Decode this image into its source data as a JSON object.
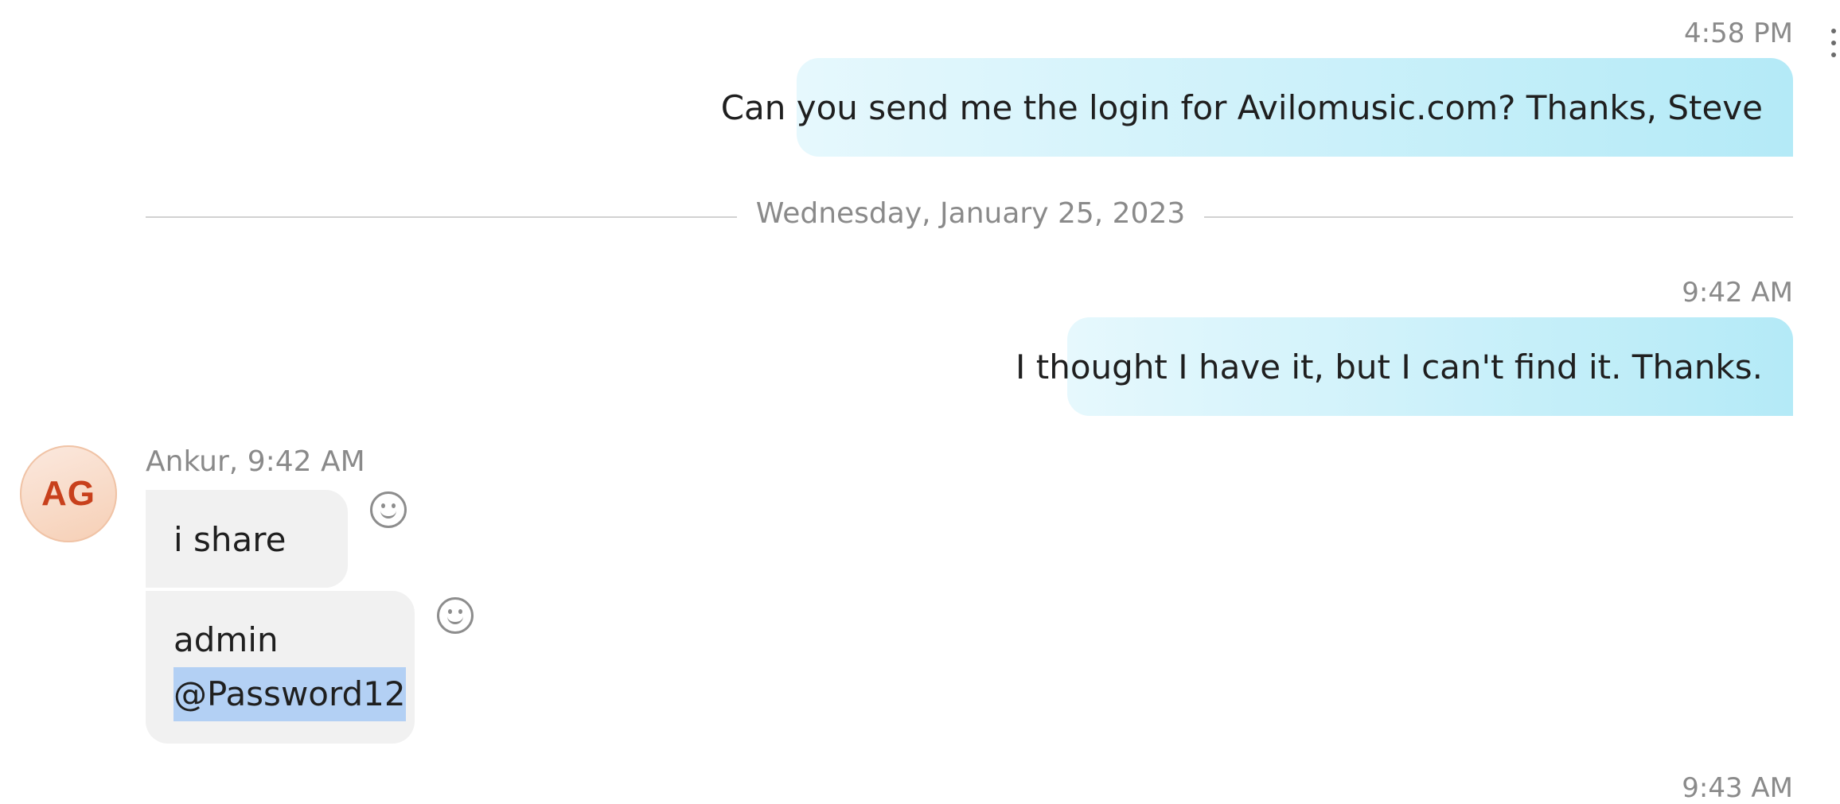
{
  "conversation": {
    "messages_out": [
      {
        "time": "4:58 PM",
        "text": "Can you send me the login for Avilomusic.com?  Thanks, Steve"
      },
      {
        "time": "9:42 AM",
        "text": "I thought I have it, but I can't find it.  Thanks."
      }
    ],
    "date_divider": "Wednesday, January 25, 2023",
    "incoming": {
      "avatar_initials": "AG",
      "sender_line": "Ankur, 9:42 AM",
      "message1": "i share",
      "message2_line1": "admin",
      "message2_line2": "@Password12"
    },
    "next_timestamp": "9:43 AM"
  },
  "icons": {
    "reaction": "smiley-face-icon",
    "menu": "more-vertical-icon"
  },
  "colors": {
    "outgoing_bubble_start": "#e6f8fd",
    "outgoing_bubble_end": "#b4eaf7",
    "incoming_bubble": "#f1f1f1",
    "avatar_text": "#c8401c",
    "selection_highlight": "#b3d0f4",
    "muted_text": "#8a8a8a"
  }
}
